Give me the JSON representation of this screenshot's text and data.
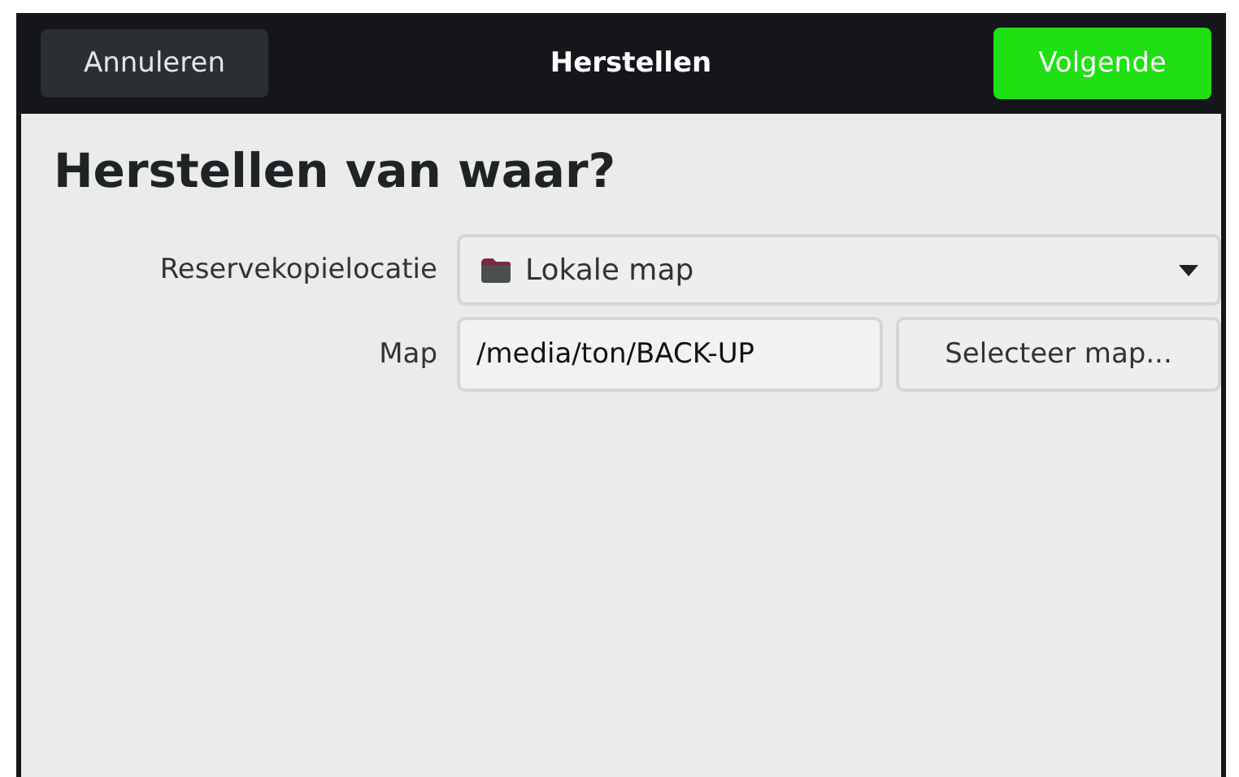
{
  "header": {
    "cancel_button": "Annuleren",
    "title": "Herstellen",
    "next_button": "Volgende"
  },
  "heading": "Herstellen van waar?",
  "form": {
    "location_label": "Reservekopielocatie",
    "location_value": "Lokale map",
    "folder_label": "Map",
    "folder_value": "/media/ton/BACK-UP",
    "select_button": "Selecteer map..."
  }
}
